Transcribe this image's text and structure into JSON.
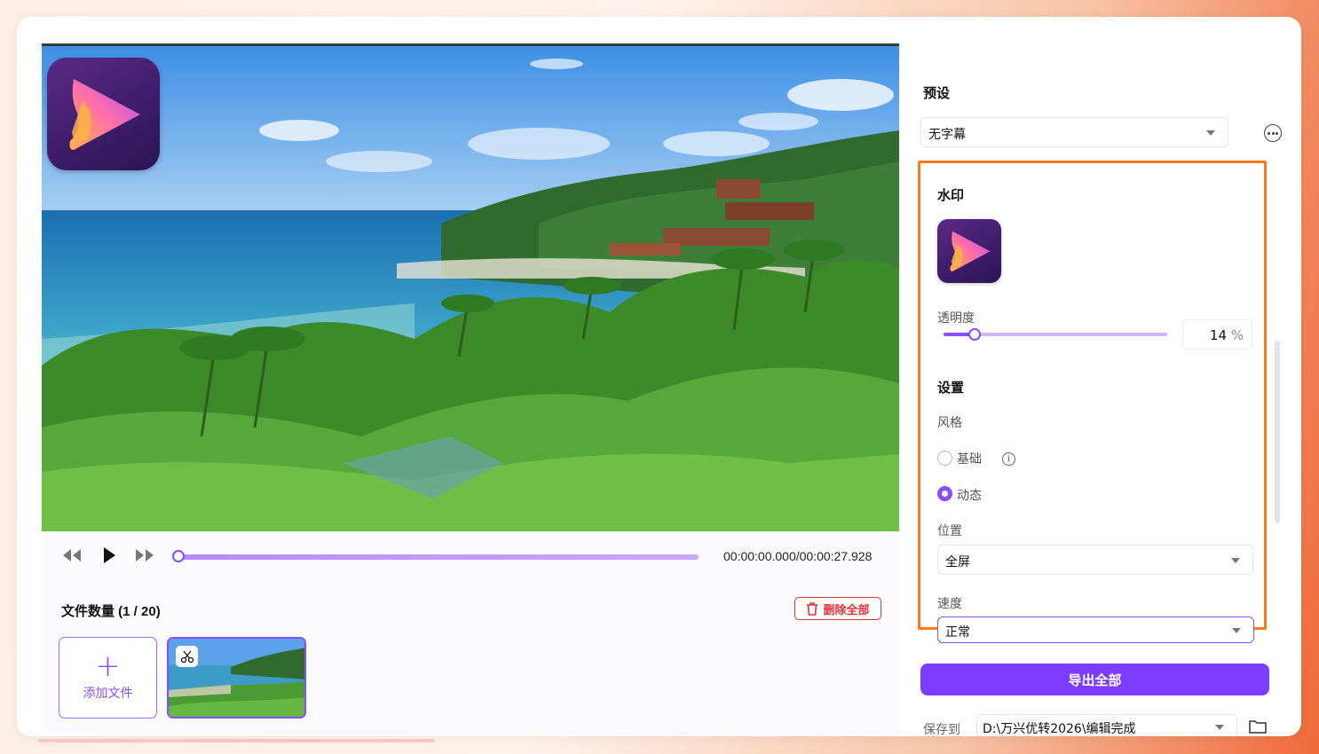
{
  "player": {
    "timecode": "00:00:00.000/00:00:27.928",
    "progress": 0.0
  },
  "files": {
    "count_label": "文件数量 (1 / 20)",
    "delete_all_label": "删除全部",
    "add_file_label": "添加文件",
    "add_icon": "+"
  },
  "panel": {
    "preset_title": "预设",
    "preset_value": "无字幕",
    "watermark_title": "水印",
    "opacity_label": "透明度",
    "opacity_value": "14",
    "opacity_unit": "%",
    "opacity_fraction": 0.14,
    "settings_title": "设置",
    "style_label": "风格",
    "style_basic": "基础",
    "style_dynamic": "动态",
    "style_selected": "动态",
    "position_label": "位置",
    "position_value": "全屏",
    "speed_label": "速度",
    "speed_value": "正常",
    "export_all_label": "导出全部",
    "save_to_label": "保存到",
    "save_path": "D:\\万兴优转2026\\编辑完成"
  },
  "colors": {
    "accent": "#8a4dff",
    "export_button": "#7c3cff",
    "highlight_border": "#ff7a1a",
    "delete_red": "#e0303a"
  },
  "icons": [
    "rewind-icon",
    "play-icon",
    "fast-forward-icon",
    "trash-icon",
    "plus-icon",
    "scissors-icon",
    "more-icon",
    "info-icon",
    "folder-icon",
    "chevron-down-icon"
  ]
}
